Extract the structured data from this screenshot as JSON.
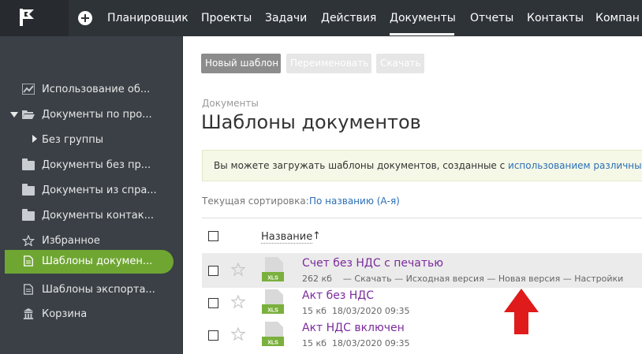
{
  "topnav": {
    "items": [
      "Планировщик",
      "Проекты",
      "Задачи",
      "Действия",
      "Документы",
      "Отчеты",
      "Контакты",
      "Компан"
    ],
    "active": "Документы"
  },
  "sidebar": {
    "items": [
      {
        "label": "Использование об...",
        "icon": "chart-icon"
      },
      {
        "label": "Документы по про...",
        "icon": "folder-open-icon"
      },
      {
        "label": "Без группы",
        "icon": "caret-right-icon"
      },
      {
        "label": "Документы без пр...",
        "icon": "folder-icon"
      },
      {
        "label": "Документы из спра...",
        "icon": "folder-icon"
      },
      {
        "label": "Документы контак...",
        "icon": "folder-icon"
      },
      {
        "label": "Избранное",
        "icon": "star-icon"
      },
      {
        "label": "Шаблоны докумен...",
        "icon": "document-icon",
        "active": true
      },
      {
        "label": "Шаблоны экспорта...",
        "icon": "document-icon"
      },
      {
        "label": "Корзина",
        "icon": "trash-icon"
      }
    ]
  },
  "toolbar": {
    "new_template": "Новый шаблон",
    "rename": "Переименовать",
    "download": "Скачать"
  },
  "page": {
    "breadcrumb": "Документы",
    "title": "Шаблоны документов",
    "notice_text": "Вы можете загружать шаблоны документов, созданные с ",
    "notice_link": "использованием различных",
    "sort_label": "Текущая сортировка:",
    "sort_value": "По названию (А-я)"
  },
  "table": {
    "column_name": "Название",
    "sort_arrow": "↑",
    "rows": [
      {
        "name": "Счет без НДС с печатью",
        "size": "262 кб",
        "actions": "— Скачать — Исходная версия — Новая версия — Настройки",
        "file_type": "XLS"
      },
      {
        "name": "Акт без НДС",
        "size": "15 кб",
        "date": "18/03/2020 09:35",
        "file_type": "XLS"
      },
      {
        "name": "Акт НДС включен",
        "size": "15 кб",
        "date": "18/03/2020 09:35",
        "file_type": "XLS"
      }
    ]
  },
  "colors": {
    "topbar": "#2e3338",
    "sidebar": "#3a4046",
    "active_green": "#6fa632",
    "link_blue": "#2b6fb6",
    "file_purple": "#7b2a9c",
    "arrow_red": "#e01b1b"
  }
}
